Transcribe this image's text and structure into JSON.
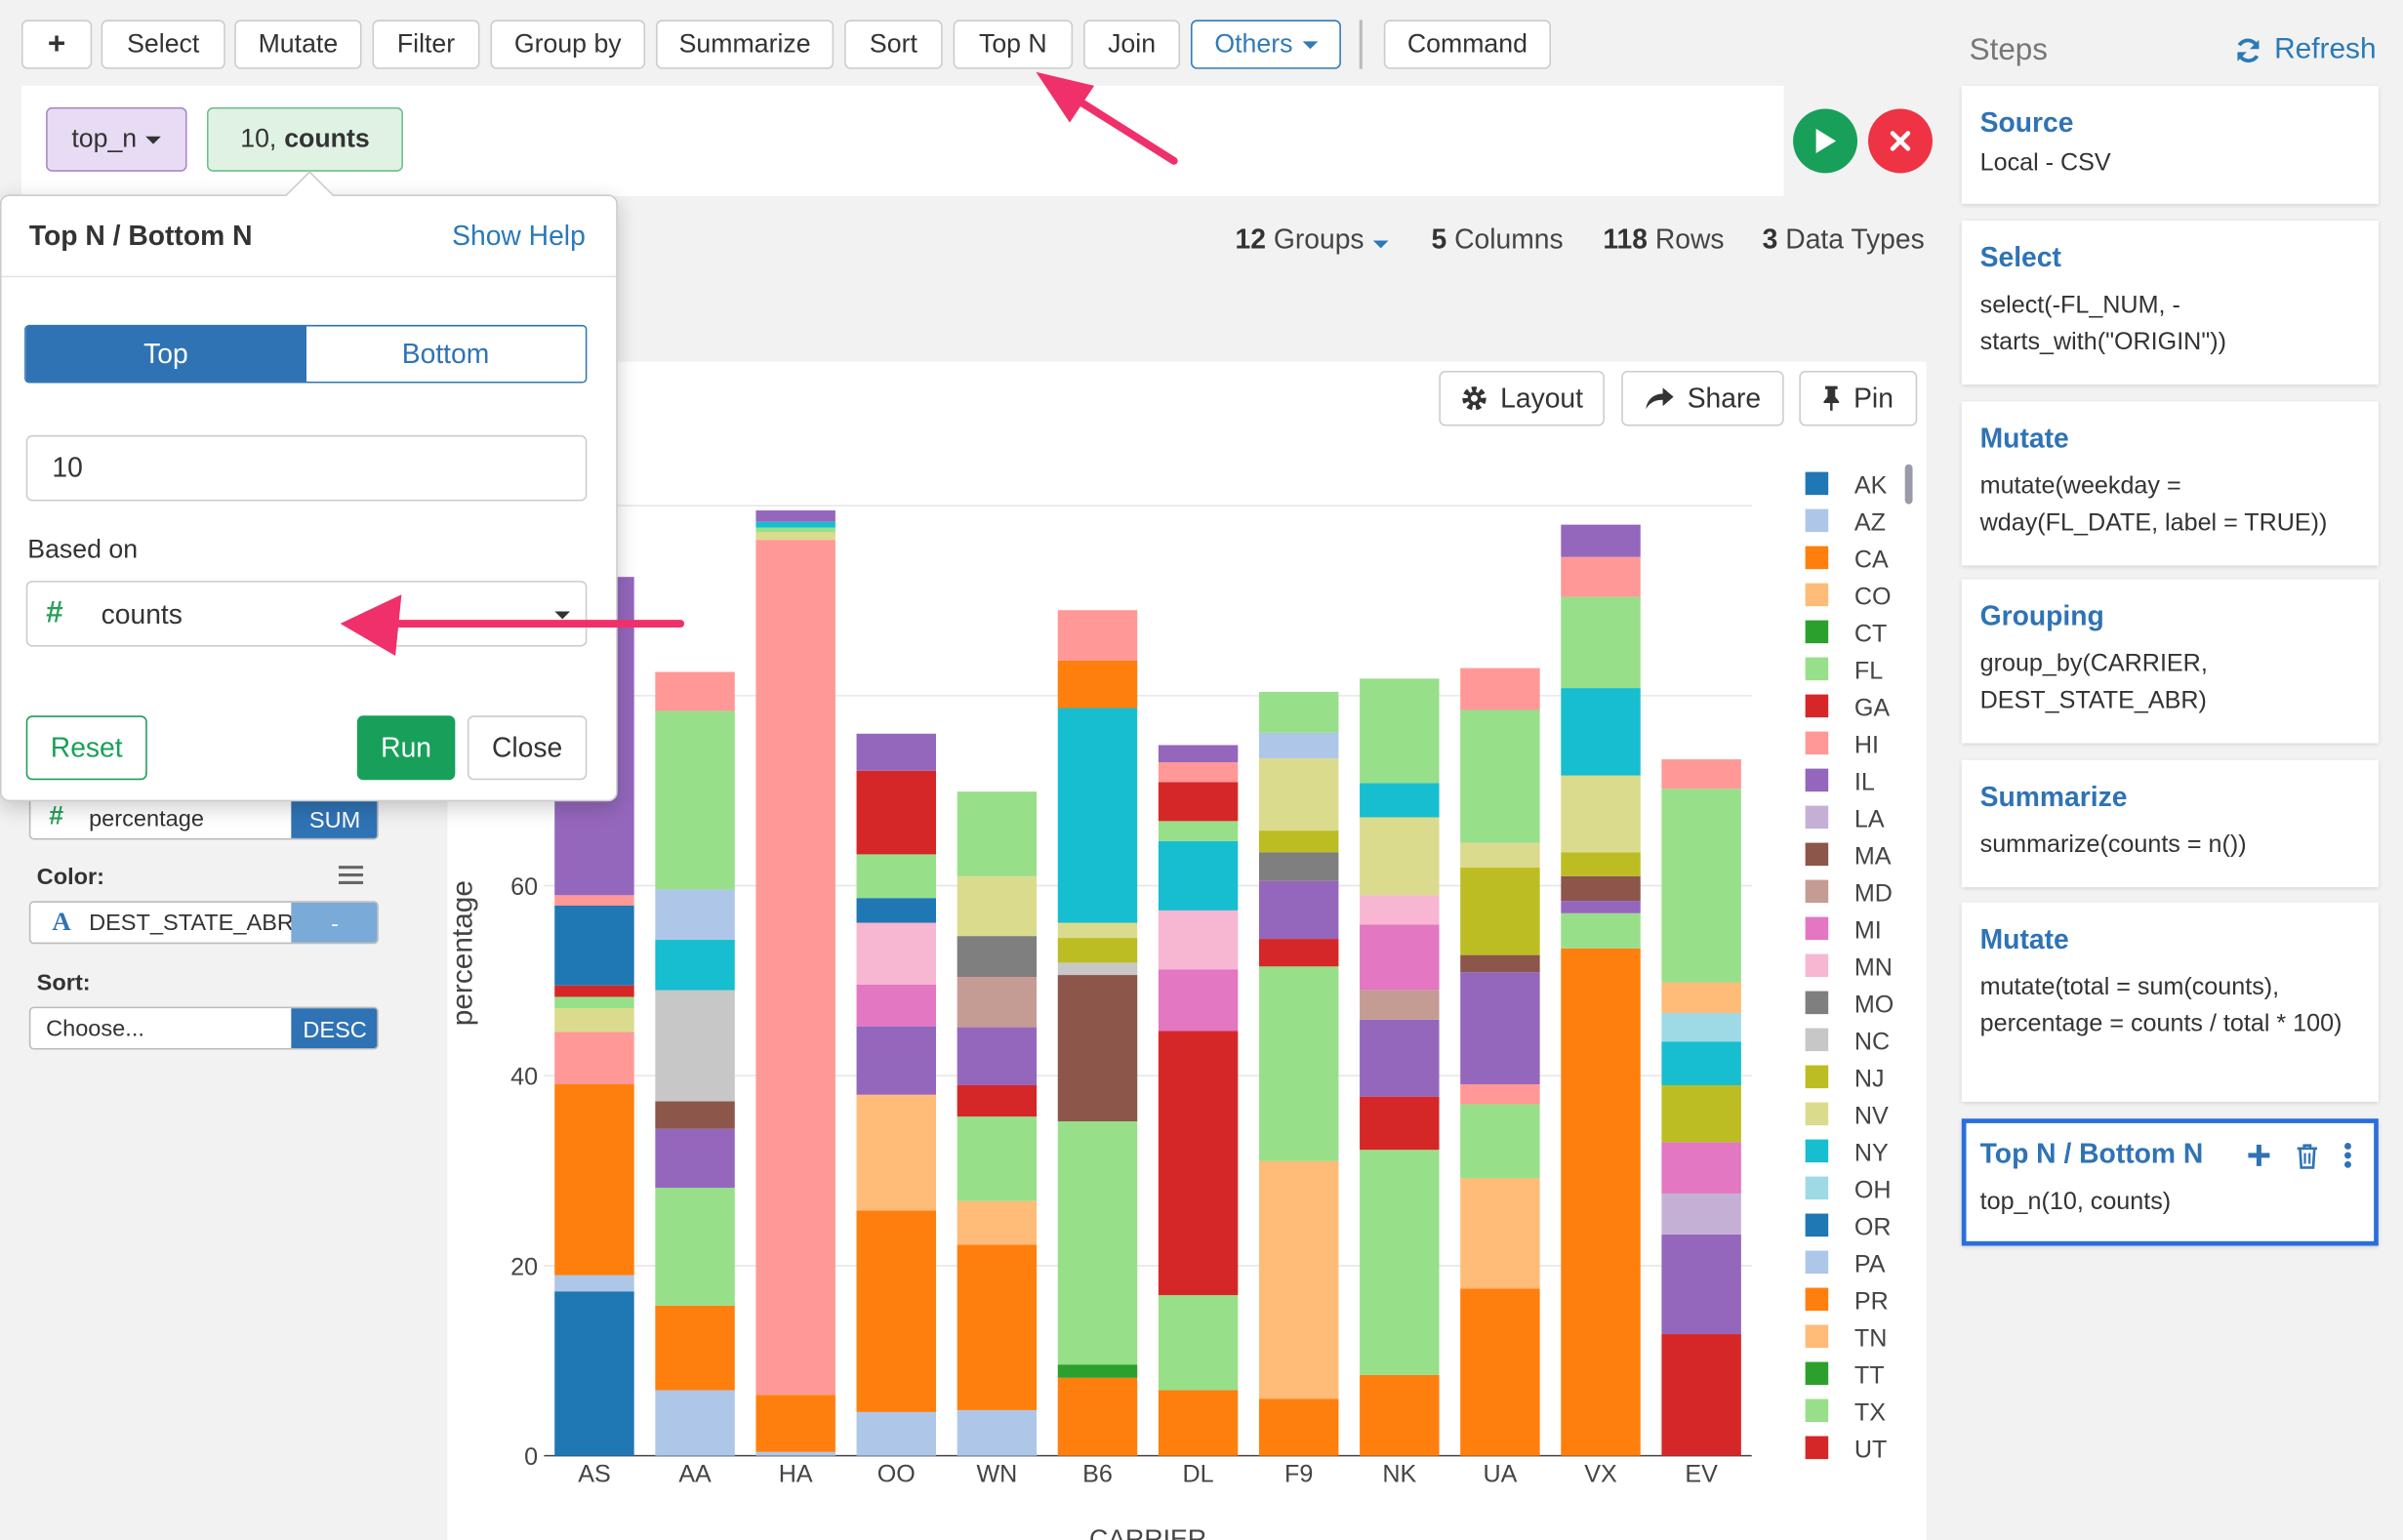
{
  "toolbar": {
    "add_label": "+",
    "items": [
      "Select",
      "Mutate",
      "Filter",
      "Group by",
      "Summarize",
      "Sort",
      "Top N",
      "Join"
    ],
    "others_label": "Others",
    "command_label": "Command"
  },
  "command": {
    "fn": "top_n",
    "arg_prefix": "10,",
    "arg_bold": "counts"
  },
  "summary": {
    "groups": "12",
    "groups_label": "Groups",
    "columns": "5",
    "columns_label": "Columns",
    "rows": "118",
    "rows_label": "Rows",
    "types": "3",
    "types_label": "Data Types"
  },
  "chart_buttons": {
    "layout": "Layout",
    "share": "Share",
    "pin": "Pin"
  },
  "popover": {
    "title": "Top N / Bottom N",
    "help": "Show Help",
    "top_label": "Top",
    "bottom_label": "Bottom",
    "n_value": "10",
    "based_on_label": "Based on",
    "based_on_value": "counts",
    "reset": "Reset",
    "run": "Run",
    "close": "Close"
  },
  "config": {
    "y_column": "percentage",
    "y_agg": "SUM",
    "color_label": "Color:",
    "color_column": "DEST_STATE_ABR",
    "color_tag": "-",
    "sort_label": "Sort:",
    "sort_placeholder": "Choose...",
    "sort_order": "DESC"
  },
  "steps": {
    "title": "Steps",
    "refresh": "Refresh",
    "items": [
      {
        "name": "Source",
        "desc": "Local - CSV"
      },
      {
        "name": "Select",
        "desc": "select(-FL_NUM, -starts_with(\"ORIGIN\"))"
      },
      {
        "name": "Mutate",
        "desc": "mutate(weekday = wday(FL_DATE, label = TRUE))"
      },
      {
        "name": "Grouping",
        "desc": "group_by(CARRIER, DEST_STATE_ABR)"
      },
      {
        "name": "Summarize",
        "desc": "summarize(counts = n())"
      },
      {
        "name": "Mutate",
        "desc": "mutate(total = sum(counts), percentage = counts / total * 100)"
      },
      {
        "name": "Top N / Bottom N",
        "desc": "top_n(10, counts)"
      }
    ]
  },
  "chart_data": {
    "type": "bar",
    "stacked": true,
    "ylabel": "percentage",
    "xlabel": "CARRIER",
    "ylim": [
      0,
      100
    ],
    "yticks": [
      0,
      20,
      40,
      60
    ],
    "grid": true,
    "legend_position": "right",
    "categories": [
      "AS",
      "AA",
      "HA",
      "OO",
      "WN",
      "B6",
      "DL",
      "F9",
      "NK",
      "UA",
      "VX",
      "EV"
    ],
    "legend": [
      {
        "state": "AK",
        "color": "#1f77b4"
      },
      {
        "state": "AZ",
        "color": "#aec7e8"
      },
      {
        "state": "CA",
        "color": "#ff7f0e"
      },
      {
        "state": "CO",
        "color": "#ffbb78"
      },
      {
        "state": "CT",
        "color": "#2ca02c"
      },
      {
        "state": "FL",
        "color": "#98df8a"
      },
      {
        "state": "GA",
        "color": "#d62728"
      },
      {
        "state": "HI",
        "color": "#ff9896"
      },
      {
        "state": "IL",
        "color": "#9467bd"
      },
      {
        "state": "LA",
        "color": "#c5b0d5"
      },
      {
        "state": "MA",
        "color": "#8c564b"
      },
      {
        "state": "MD",
        "color": "#c49c94"
      },
      {
        "state": "MI",
        "color": "#e377c2"
      },
      {
        "state": "MN",
        "color": "#f7b6d2"
      },
      {
        "state": "MO",
        "color": "#7f7f7f"
      },
      {
        "state": "NC",
        "color": "#c7c7c7"
      },
      {
        "state": "NJ",
        "color": "#bcbd22"
      },
      {
        "state": "NV",
        "color": "#dbdb8d"
      },
      {
        "state": "NY",
        "color": "#17becf"
      },
      {
        "state": "OH",
        "color": "#9edae5"
      },
      {
        "state": "OR",
        "color": "#1f77b4"
      },
      {
        "state": "PA",
        "color": "#aec7e8"
      },
      {
        "state": "PR",
        "color": "#ff7f0e"
      },
      {
        "state": "TN",
        "color": "#ffbb78"
      },
      {
        "state": "TT",
        "color": "#2ca02c"
      },
      {
        "state": "TX",
        "color": "#98df8a"
      },
      {
        "state": "UT",
        "color": "#d62728"
      }
    ],
    "bars": [
      {
        "category": "AS",
        "segments": [
          [
            "AK",
            17.3
          ],
          [
            "AZ",
            1.7
          ],
          [
            "CA",
            20.1
          ],
          [
            "HI",
            5.5
          ],
          [
            "NV",
            2.5
          ],
          [
            "FL",
            1.2
          ],
          [
            "GA",
            1.2
          ],
          [
            "OR",
            8.4
          ],
          [
            "HI",
            1.1
          ],
          [
            "IL",
            33.5
          ]
        ]
      },
      {
        "category": "AA",
        "segments": [
          [
            "AZ",
            6.9
          ],
          [
            "CA",
            8.9
          ],
          [
            "FL",
            12.4
          ],
          [
            "IL",
            6.2
          ],
          [
            "MA",
            2.9
          ],
          [
            "NC",
            11.7
          ],
          [
            "NY",
            5.3
          ],
          [
            "PA",
            5.3
          ],
          [
            "FL",
            18.8
          ],
          [
            "HI",
            4.1
          ]
        ]
      },
      {
        "category": "HA",
        "segments": [
          [
            "AZ",
            0.4
          ],
          [
            "CA",
            6.0
          ],
          [
            "HI",
            90.0
          ],
          [
            "NV",
            0.8
          ],
          [
            "FL",
            0.5
          ],
          [
            "NY",
            0.6
          ],
          [
            "IL",
            1.2
          ]
        ]
      },
      {
        "category": "OO",
        "segments": [
          [
            "AZ",
            4.6
          ],
          [
            "CA",
            21.2
          ],
          [
            "CO",
            12.2
          ],
          [
            "IL",
            7.2
          ],
          [
            "MI",
            4.4
          ],
          [
            "MN",
            6.5
          ],
          [
            "OR",
            2.6
          ],
          [
            "FL",
            4.6
          ],
          [
            "GA",
            8.8
          ],
          [
            "IL",
            3.9
          ]
        ]
      },
      {
        "category": "WN",
        "segments": [
          [
            "AZ",
            4.8
          ],
          [
            "CA",
            17.4
          ],
          [
            "CO",
            4.6
          ],
          [
            "FL",
            8.9
          ],
          [
            "GA",
            3.3
          ],
          [
            "IL",
            6.1
          ],
          [
            "MD",
            5.3
          ],
          [
            "MO",
            4.3
          ],
          [
            "NV",
            6.3
          ],
          [
            "FL",
            8.9
          ]
        ]
      },
      {
        "category": "B6",
        "segments": [
          [
            "CA",
            8.2
          ],
          [
            "CT",
            1.4
          ],
          [
            "FL",
            25.6
          ],
          [
            "MA",
            15.4
          ],
          [
            "NC",
            1.3
          ],
          [
            "NJ",
            2.6
          ],
          [
            "NV",
            1.6
          ],
          [
            "NY",
            22.6
          ],
          [
            "CA",
            5.0
          ],
          [
            "HI",
            5.3
          ]
        ]
      },
      {
        "category": "DL",
        "segments": [
          [
            "CA",
            6.9
          ],
          [
            "FL",
            10.0
          ],
          [
            "GA",
            27.8
          ],
          [
            "MI",
            6.5
          ],
          [
            "MN",
            6.2
          ],
          [
            "NY",
            7.3
          ],
          [
            "FL",
            2.1
          ],
          [
            "GA",
            4.1
          ],
          [
            "HI",
            2.1
          ],
          [
            "IL",
            1.8
          ]
        ]
      },
      {
        "category": "F9",
        "segments": [
          [
            "CA",
            6.0
          ],
          [
            "CO",
            25.0
          ],
          [
            "FL",
            20.5
          ],
          [
            "GA",
            2.9
          ],
          [
            "IL",
            6.1
          ],
          [
            "MO",
            3.0
          ],
          [
            "NJ",
            2.3
          ],
          [
            "NV",
            7.6
          ],
          [
            "PA",
            2.7
          ],
          [
            "FL",
            4.3
          ]
        ]
      },
      {
        "category": "NK",
        "segments": [
          [
            "CA",
            8.5
          ],
          [
            "FL",
            23.7
          ],
          [
            "GA",
            5.6
          ],
          [
            "IL",
            8.1
          ],
          [
            "MD",
            3.1
          ],
          [
            "MI",
            6.9
          ],
          [
            "MN",
            3.1
          ],
          [
            "NV",
            8.2
          ],
          [
            "NY",
            3.6
          ],
          [
            "FL",
            11.0
          ]
        ]
      },
      {
        "category": "UA",
        "segments": [
          [
            "CA",
            17.6
          ],
          [
            "CO",
            11.6
          ],
          [
            "FL",
            7.8
          ],
          [
            "HI",
            2.1
          ],
          [
            "IL",
            11.8
          ],
          [
            "MA",
            1.8
          ],
          [
            "NJ",
            9.2
          ],
          [
            "NV",
            2.6
          ],
          [
            "FL",
            14.0
          ],
          [
            "HI",
            4.4
          ]
        ]
      },
      {
        "category": "VX",
        "segments": [
          [
            "CA",
            53.4
          ],
          [
            "FL",
            3.7
          ],
          [
            "IL",
            1.3
          ],
          [
            "MA",
            2.6
          ],
          [
            "NJ",
            2.5
          ],
          [
            "NV",
            8.1
          ],
          [
            "NY",
            9.2
          ],
          [
            "FL",
            9.6
          ],
          [
            "HI",
            4.2
          ],
          [
            "IL",
            3.4
          ]
        ]
      },
      {
        "category": "EV",
        "segments": [
          [
            "GA",
            12.8
          ],
          [
            "IL",
            10.5
          ],
          [
            "LA",
            4.3
          ],
          [
            "MI",
            5.4
          ],
          [
            "NJ",
            6.0
          ],
          [
            "NY",
            4.6
          ],
          [
            "OH",
            3.0
          ],
          [
            "CO",
            3.2
          ],
          [
            "FL",
            20.4
          ],
          [
            "HI",
            3.1
          ]
        ]
      }
    ]
  }
}
